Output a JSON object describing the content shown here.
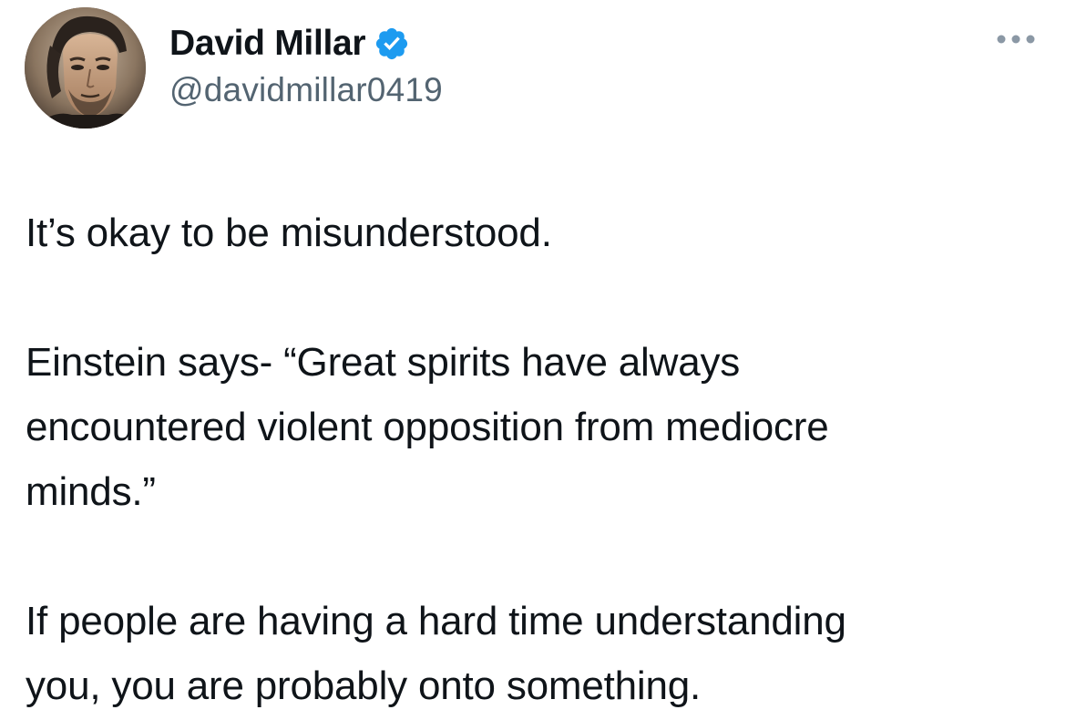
{
  "author": {
    "name": "David Millar",
    "handle": "@davidmillar0419",
    "verified": true,
    "avatar_icon": "profile-photo"
  },
  "tweet": {
    "paragraphs": [
      "It’s okay to be misunderstood.",
      "Einstein says- “Great spirits have always\nencountered violent opposition from mediocre\nminds.”",
      "If people are having a hard time understanding\nyou, you are probably onto something."
    ]
  },
  "icons": {
    "verified": "verified-badge-icon",
    "more": "more-options-icon"
  },
  "colors": {
    "text": "#0f1419",
    "secondary": "#536471",
    "verified_blue": "#1d9bf0",
    "more_dots": "#8b98a5"
  }
}
